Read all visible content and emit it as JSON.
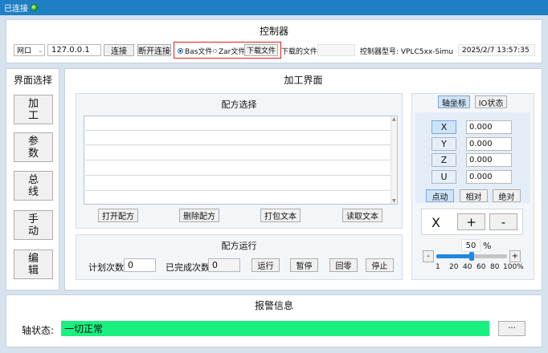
{
  "titlebar": {
    "status_text": "已连接"
  },
  "controller": {
    "title": "控制器",
    "conn_type": "网口",
    "ip": "127.0.0.1",
    "connect_label": "连接",
    "disconnect_label": "断开连接",
    "radio_bas": "Bas文件",
    "radio_zar": "Zar文件",
    "download_label": "下载文件",
    "downloaded_file_label": "下载的文件:",
    "downloaded_file_value": "",
    "model_label": "控制器型号: VPLC5xx-Simu",
    "datetime": "2025/2/7 13:57:35"
  },
  "nav": {
    "title": "界面选择",
    "items": [
      {
        "label": "加工"
      },
      {
        "label": "参数"
      },
      {
        "label": "总线"
      },
      {
        "label": "手动"
      },
      {
        "label": "编辑"
      }
    ]
  },
  "process": {
    "title": "加工界面",
    "recipe_select": {
      "title": "配方选择",
      "open_label": "打开配方",
      "delete_label": "删除配方",
      "pack_label": "打包文本",
      "read_label": "读取文本"
    },
    "recipe_run": {
      "title": "配方运行",
      "planned_label": "计划次数",
      "planned_value": "0",
      "done_label": "已完成次数",
      "done_value": "0",
      "run_label": "运行",
      "pause_label": "暂停",
      "home_label": "回零",
      "stop_label": "停止"
    }
  },
  "axis": {
    "tab_coord": "轴坐标",
    "tab_io": "IO状态",
    "rows": [
      {
        "name": "X",
        "value": "0.000"
      },
      {
        "name": "Y",
        "value": "0.000"
      },
      {
        "name": "Z",
        "value": "0.000"
      },
      {
        "name": "U",
        "value": "0.000"
      }
    ],
    "mode_jog": "点动",
    "mode_rel": "相对",
    "mode_abs": "绝对",
    "jog_axis": "X",
    "plus_label": "+",
    "minus_label": "-",
    "speed_value": "50",
    "speed_unit": "%",
    "speed_percent": 50,
    "slider_minus": "-",
    "slider_plus": "+",
    "ticks": [
      "1",
      "20",
      "40",
      "60",
      "80",
      "100%"
    ]
  },
  "alarm": {
    "title": "报警信息",
    "axis_state_label": "轴状态:",
    "axis_state_value": "一切正常",
    "more_label": "···",
    "ok_color": "#19f07f"
  }
}
